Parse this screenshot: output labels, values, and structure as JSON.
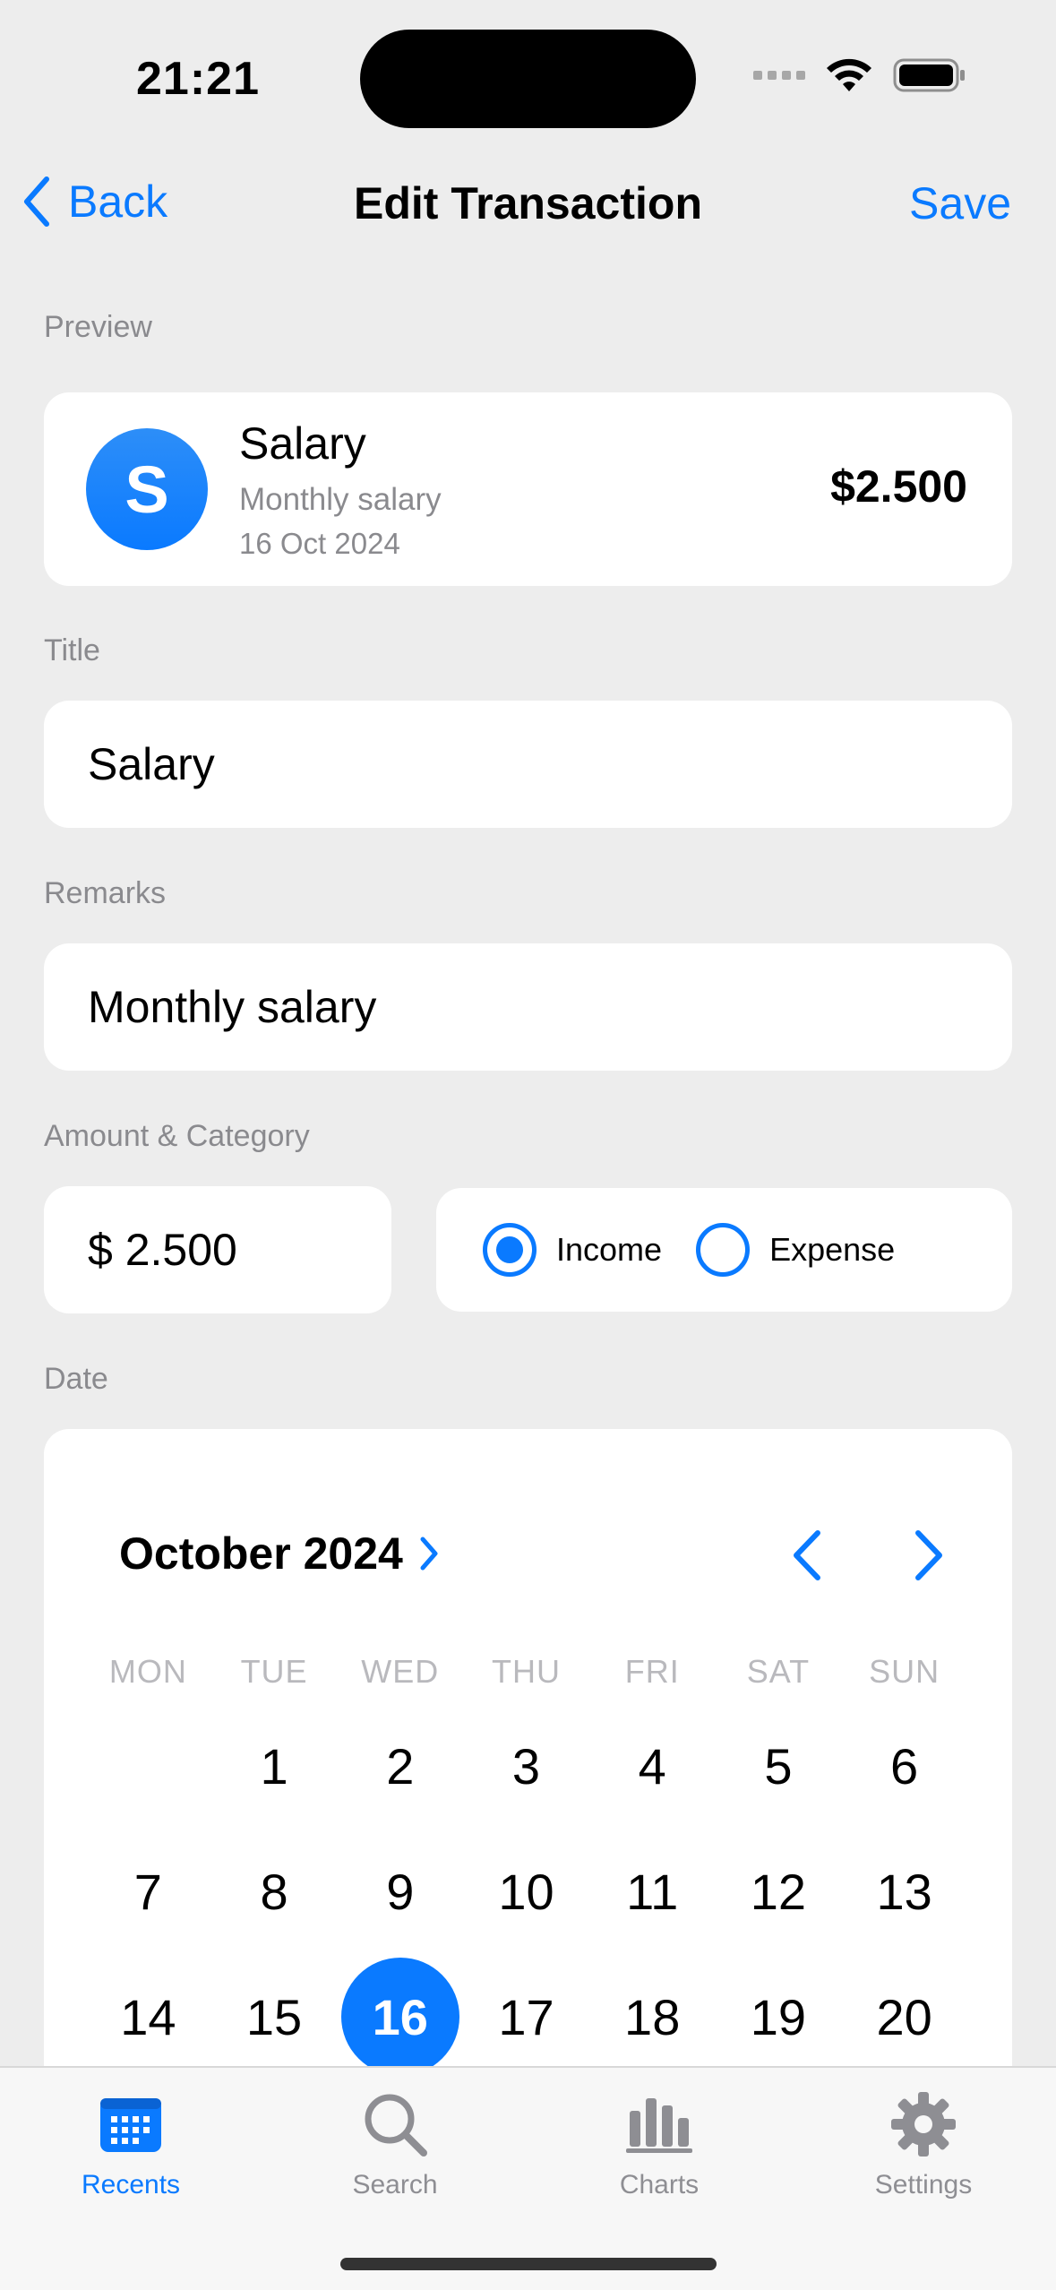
{
  "status_bar": {
    "time": "21:21"
  },
  "nav": {
    "back_label": "Back",
    "title": "Edit Transaction",
    "save_label": "Save"
  },
  "preview": {
    "section_label": "Preview",
    "avatar_letter": "S",
    "title": "Salary",
    "remarks": "Monthly salary",
    "date": "16 Oct 2024",
    "amount": "$2.500"
  },
  "title_field": {
    "section_label": "Title",
    "value": "Salary"
  },
  "remarks_field": {
    "section_label": "Remarks",
    "value": "Monthly salary"
  },
  "amount_category": {
    "section_label": "Amount & Category",
    "amount_value": "$ 2.500",
    "options": [
      "Income",
      "Expense"
    ],
    "selected": "Income"
  },
  "date": {
    "section_label": "Date",
    "month_label": "October 2024",
    "weekdays": [
      "MON",
      "TUE",
      "WED",
      "THU",
      "FRI",
      "SAT",
      "SUN"
    ],
    "days": [
      "",
      "1",
      "2",
      "3",
      "4",
      "5",
      "6",
      "7",
      "8",
      "9",
      "10",
      "11",
      "12",
      "13",
      "14",
      "15",
      "16",
      "17",
      "18",
      "19",
      "20"
    ],
    "selected_day": "16"
  },
  "tabbar": {
    "tabs": [
      {
        "label": "Recents",
        "icon": "calendar-icon",
        "active": true
      },
      {
        "label": "Search",
        "icon": "magnifier-icon",
        "active": false
      },
      {
        "label": "Charts",
        "icon": "bar-chart-icon",
        "active": false
      },
      {
        "label": "Settings",
        "icon": "gear-icon",
        "active": false
      }
    ]
  },
  "colors": {
    "accent": "#0A7AFF",
    "background": "#EDEDED",
    "card": "#FFFFFF",
    "secondary_text": "#8A8A8E"
  }
}
